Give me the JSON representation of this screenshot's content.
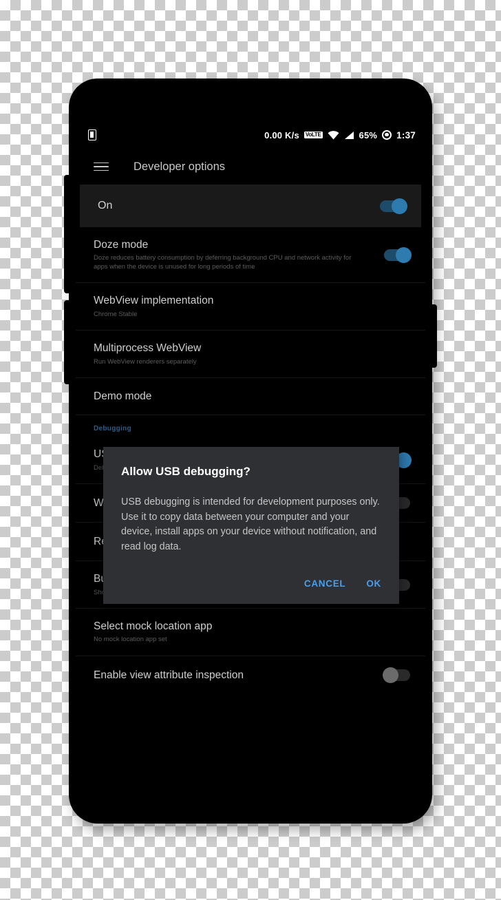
{
  "statusbar": {
    "notification_icon": "usb-notification-icon",
    "network_speed": "0.00 K/s",
    "volte_label": "VoLTE",
    "wifi_icon": "wifi-icon",
    "signal_icon": "cellular-signal-icon",
    "battery": "65%",
    "alarm_icon": "alarm-icon",
    "time": "1:37"
  },
  "appbar": {
    "menu_icon": "hamburger-menu-icon",
    "title": "Developer options"
  },
  "master": {
    "label": "On",
    "state": "on"
  },
  "rows": [
    {
      "title": "Doze mode",
      "subtitle": "Doze reduces battery consumption by deferring background CPU and network activity for apps when the device is unused for long periods of time",
      "toggle": "on"
    },
    {
      "title": "WebView implementation",
      "subtitle": "Chrome Stable",
      "toggle": "none"
    },
    {
      "title": "Multiprocess WebView",
      "subtitle": "Run WebView renderers separately",
      "toggle": "none"
    },
    {
      "title": "Demo mode",
      "subtitle": "",
      "toggle": "none"
    }
  ],
  "section_debugging": "Debugging",
  "rows2": [
    {
      "title": "USB debugging",
      "subtitle": "Debug mode when USB is connected",
      "toggle": "on"
    },
    {
      "title": "Wireless ADB debugging",
      "subtitle": "",
      "toggle": "off"
    },
    {
      "title": "Revoke USB debugging authorizations",
      "subtitle": "",
      "toggle": "none"
    },
    {
      "title": "Bug report shortcut",
      "subtitle": "Show a button in the power menu for taking a bug report",
      "toggle": "off"
    },
    {
      "title": "Select mock location app",
      "subtitle": "No mock location app set",
      "toggle": "none"
    },
    {
      "title": "Enable view attribute inspection",
      "subtitle": "",
      "toggle": "off"
    }
  ],
  "dialog": {
    "title": "Allow USB debugging?",
    "body": "USB debugging is intended for development purposes only. Use it to copy data between your computer and your device, install apps on your device without notification, and read log data.",
    "cancel_label": "CANCEL",
    "ok_label": "OK"
  },
  "colors": {
    "accent_blue": "#4a9eea",
    "toggle_on": "#2e7bb0",
    "toggle_off": "#6b6b6b",
    "dialog_bg": "#2e3033",
    "screen_bg": "#000000"
  }
}
